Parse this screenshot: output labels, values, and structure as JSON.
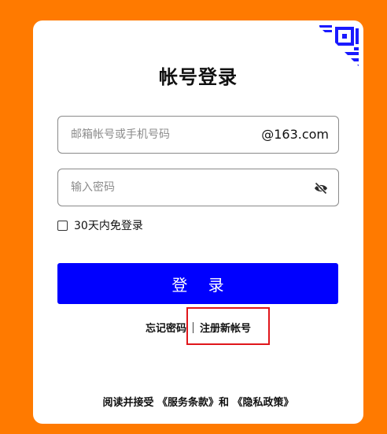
{
  "login": {
    "title": "帐号登录",
    "account_placeholder": "邮箱帐号或手机号码",
    "domain_suffix": "@163.com",
    "password_placeholder": "输入密码",
    "remember_label": "30天内免登录",
    "login_button": "登 录",
    "forgot_password": "忘记密码",
    "register": "注册新帐号",
    "terms_prefix": "阅读并接受 ",
    "terms_service": "《服务条款》",
    "terms_and": "和 ",
    "terms_privacy": "《隐私政策》"
  },
  "icons": {
    "qr_corner": "qr-code-icon",
    "password_toggle": "eye-slash-icon"
  },
  "colors": {
    "background": "#ff7a00",
    "primary_button": "#0000ff",
    "qr_accent": "#1a1aff",
    "highlight": "#e0161b"
  }
}
